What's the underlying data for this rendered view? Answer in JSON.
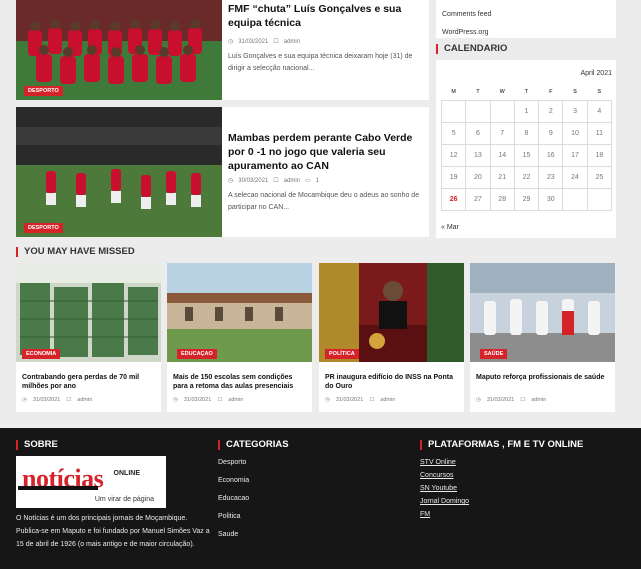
{
  "articles": [
    {
      "title": "FMF “chuta” Luís Gonçalves e sua equipa técnica",
      "date": "31/03/2021",
      "author": "admin",
      "comments": "",
      "excerpt": "Luís Gonçalves e sua equipa técnica deixaram hoje (31) de dirigir a selecção nacional...",
      "category": "DESPORTO"
    },
    {
      "title": "Mambas perdem perante Cabo Verde por 0 -1 no jogo que valeria seu apuramento ao CAN",
      "date": "30/03/2021",
      "author": "admin",
      "comments": "1",
      "excerpt": "A selecao nacional de Mocambique deu o adeus ao sonho de participar no CAN...",
      "category": "DESPORTO"
    }
  ],
  "sidebar": {
    "meta_links": [
      "Comments feed",
      "WordPress.org"
    ],
    "calendar_heading": "CALENDARIO",
    "calendar": {
      "month": "April 2021",
      "weekdays": [
        "M",
        "T",
        "W",
        "T",
        "F",
        "S",
        "S"
      ],
      "weeks": [
        [
          "",
          "",
          "",
          "1",
          "2",
          "3",
          "4"
        ],
        [
          "5",
          "6",
          "7",
          "8",
          "9",
          "10",
          "11"
        ],
        [
          "12",
          "13",
          "14",
          "15",
          "16",
          "17",
          "18"
        ],
        [
          "19",
          "20",
          "21",
          "22",
          "23",
          "24",
          "25"
        ],
        [
          "26",
          "27",
          "28",
          "29",
          "30",
          "",
          ""
        ]
      ],
      "today": "26",
      "prev_link": "« Mar"
    }
  },
  "missed": {
    "heading": "YOU MAY HAVE MISSED",
    "cards": [
      {
        "title": "Contrabando gera perdas de 70 mil milhões por ano",
        "category": "ECONOMIA",
        "date": "31/03/2021",
        "author": "admin"
      },
      {
        "title": "Mais de 150 escolas sem condições para a retoma das aulas presenciais",
        "category": "EDUCAÇAO",
        "date": "31/03/2021",
        "author": "admin"
      },
      {
        "title": "PR inaugura edifício do INSS na Ponta do Ouro",
        "category": "POLÍTICA",
        "date": "31/03/2021",
        "author": "admin"
      },
      {
        "title": "Maputo reforça profissionais de saúde",
        "category": "SAÚDE",
        "date": "31/03/2021",
        "author": "admin"
      }
    ]
  },
  "footer": {
    "about_heading": "SOBRE",
    "logo_online": "ONLINE",
    "logo_name": "notícias",
    "logo_tagline": "Um virar de página",
    "about_text": "O Notícias é um dos principais jornais de Moçambique. Publica-se em Maputo e foi fundado por Manuel Simões Vaz a 15 de abril de 1926 (o mais antigo e de maior circulação).",
    "categories_heading": "CATEGORIAS",
    "categories": [
      "Desporto",
      "Economia",
      "Educacao",
      "Politica",
      "Saude"
    ],
    "platforms_heading": "PLATAFORMAS , FM E TV ONLINE",
    "platforms": [
      "STV Online",
      "Concursos",
      "SN Youtube",
      "Jornal Domingo",
      "FM"
    ]
  },
  "colors": {
    "accent": "#d6232a",
    "footer_bg": "#161616",
    "page_bg": "#ececec"
  },
  "icons": [
    "clock-icon",
    "user-icon",
    "comment-icon"
  ]
}
